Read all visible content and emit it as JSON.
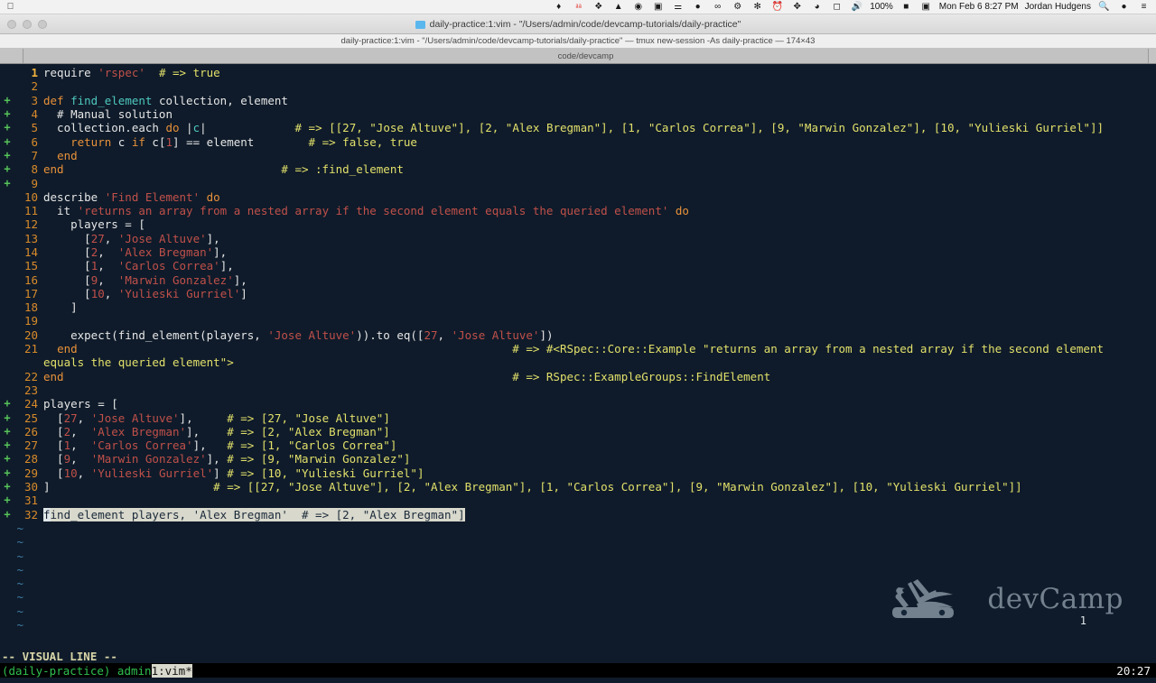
{
  "menubar": {
    "left_icons": [
      "apple-icon"
    ],
    "status_icons": [
      "pin-icon",
      "1password-icon",
      "dropbox-icon",
      "droplet-icon",
      "globe-icon",
      "camera-icon",
      "antenna-icon",
      "evernote-icon",
      "infinity-icon",
      "robot-icon",
      "bug-icon",
      "clock-icon",
      "bluetooth-icon",
      "wifi-icon",
      "airplay-icon",
      "volume-icon"
    ],
    "battery_text": "100%",
    "battery_icon": "battery-icon",
    "screen_icon": "display-icon",
    "datetime": "Mon Feb 6  8:27 PM",
    "user": "Jordan Hudgens",
    "search_icon": "search-icon",
    "siri_icon": "siri-icon",
    "notification_icon": "notification-center-icon"
  },
  "window": {
    "title": "daily-practice:1:vim - \"/Users/admin/code/devcamp-tutorials/daily-practice\"",
    "folder_icon": "folder-icon",
    "subtitle": "daily-practice:1:vim - \"/Users/admin/code/devcamp-tutorials/daily-practice\"  — tmux new-session -As daily-practice — 174×43",
    "tab_label": "code/devcamp"
  },
  "editor": {
    "lines": [
      {
        "sign": "",
        "num": "1",
        "cur": true,
        "segs": [
          {
            "t": "require ",
            "c": "c-plain"
          },
          {
            "t": "'rspec'",
            "c": "c-str"
          },
          {
            "t": "  ",
            "c": "c-plain"
          },
          {
            "t": "# => true",
            "c": "c-cmt"
          }
        ]
      },
      {
        "sign": "",
        "num": "2",
        "segs": []
      },
      {
        "sign": "+",
        "num": "3",
        "segs": [
          {
            "t": "def ",
            "c": "c-kw"
          },
          {
            "t": "find_element",
            "c": "c-func"
          },
          {
            "t": " collection, element",
            "c": "c-plain"
          }
        ]
      },
      {
        "sign": "+",
        "num": "4",
        "segs": [
          {
            "t": "  # Manual solution",
            "c": "c-plain"
          }
        ]
      },
      {
        "sign": "+",
        "num": "5",
        "segs": [
          {
            "t": "  collection.each ",
            "c": "c-plain"
          },
          {
            "t": "do",
            "c": "c-kw"
          },
          {
            "t": " |",
            "c": "c-plain"
          },
          {
            "t": "c",
            "c": "c-func"
          },
          {
            "t": "|",
            "c": "c-plain"
          },
          {
            "t": "             ",
            "c": "c-plain"
          },
          {
            "t": "# => [[27, \"Jose Altuve\"], [2, \"Alex Bregman\"], [1, \"Carlos Correa\"], [9, \"Marwin Gonzalez\"], [10, \"Yulieski Gurriel\"]]",
            "c": "c-cmt"
          }
        ]
      },
      {
        "sign": "+",
        "num": "6",
        "segs": [
          {
            "t": "    ",
            "c": "c-plain"
          },
          {
            "t": "return",
            "c": "c-kw"
          },
          {
            "t": " c ",
            "c": "c-plain"
          },
          {
            "t": "if",
            "c": "c-kw"
          },
          {
            "t": " c[",
            "c": "c-plain"
          },
          {
            "t": "1",
            "c": "c-num"
          },
          {
            "t": "] == element",
            "c": "c-plain"
          },
          {
            "t": "        ",
            "c": "c-plain"
          },
          {
            "t": "# => false, true",
            "c": "c-cmt"
          }
        ]
      },
      {
        "sign": "+",
        "num": "7",
        "segs": [
          {
            "t": "  ",
            "c": "c-plain"
          },
          {
            "t": "end",
            "c": "c-kw"
          }
        ]
      },
      {
        "sign": "+",
        "num": "8",
        "segs": [
          {
            "t": "end",
            "c": "c-kw"
          },
          {
            "t": "                                ",
            "c": "c-plain"
          },
          {
            "t": "# => :find_element",
            "c": "c-cmt"
          }
        ]
      },
      {
        "sign": "+",
        "num": "9",
        "segs": []
      },
      {
        "sign": "",
        "num": "10",
        "segs": [
          {
            "t": "describe ",
            "c": "c-plain"
          },
          {
            "t": "'Find Element'",
            "c": "c-str"
          },
          {
            "t": " ",
            "c": "c-plain"
          },
          {
            "t": "do",
            "c": "c-kw"
          }
        ]
      },
      {
        "sign": "",
        "num": "11",
        "segs": [
          {
            "t": "  it ",
            "c": "c-plain"
          },
          {
            "t": "'returns an array from a nested array if the second element equals the queried element'",
            "c": "c-str"
          },
          {
            "t": " ",
            "c": "c-plain"
          },
          {
            "t": "do",
            "c": "c-kw"
          }
        ]
      },
      {
        "sign": "",
        "num": "12",
        "segs": [
          {
            "t": "    players = [",
            "c": "c-plain"
          }
        ]
      },
      {
        "sign": "",
        "num": "13",
        "segs": [
          {
            "t": "      [",
            "c": "c-plain"
          },
          {
            "t": "27",
            "c": "c-num"
          },
          {
            "t": ", ",
            "c": "c-plain"
          },
          {
            "t": "'Jose Altuve'",
            "c": "c-str"
          },
          {
            "t": "],",
            "c": "c-plain"
          }
        ]
      },
      {
        "sign": "",
        "num": "14",
        "segs": [
          {
            "t": "      [",
            "c": "c-plain"
          },
          {
            "t": "2",
            "c": "c-num"
          },
          {
            "t": ",  ",
            "c": "c-plain"
          },
          {
            "t": "'Alex Bregman'",
            "c": "c-str"
          },
          {
            "t": "],",
            "c": "c-plain"
          }
        ]
      },
      {
        "sign": "",
        "num": "15",
        "segs": [
          {
            "t": "      [",
            "c": "c-plain"
          },
          {
            "t": "1",
            "c": "c-num"
          },
          {
            "t": ",  ",
            "c": "c-plain"
          },
          {
            "t": "'Carlos Correa'",
            "c": "c-str"
          },
          {
            "t": "],",
            "c": "c-plain"
          }
        ]
      },
      {
        "sign": "",
        "num": "16",
        "segs": [
          {
            "t": "      [",
            "c": "c-plain"
          },
          {
            "t": "9",
            "c": "c-num"
          },
          {
            "t": ",  ",
            "c": "c-plain"
          },
          {
            "t": "'Marwin Gonzalez'",
            "c": "c-str"
          },
          {
            "t": "],",
            "c": "c-plain"
          }
        ]
      },
      {
        "sign": "",
        "num": "17",
        "segs": [
          {
            "t": "      [",
            "c": "c-plain"
          },
          {
            "t": "10",
            "c": "c-num"
          },
          {
            "t": ", ",
            "c": "c-plain"
          },
          {
            "t": "'Yulieski Gurriel'",
            "c": "c-str"
          },
          {
            "t": "]",
            "c": "c-plain"
          }
        ]
      },
      {
        "sign": "",
        "num": "18",
        "segs": [
          {
            "t": "    ]",
            "c": "c-plain"
          }
        ]
      },
      {
        "sign": "",
        "num": "19",
        "segs": []
      },
      {
        "sign": "",
        "num": "20",
        "segs": [
          {
            "t": "    expect(find_element(players, ",
            "c": "c-plain"
          },
          {
            "t": "'Jose Altuve'",
            "c": "c-str"
          },
          {
            "t": ")).to eq([",
            "c": "c-plain"
          },
          {
            "t": "27",
            "c": "c-num"
          },
          {
            "t": ", ",
            "c": "c-plain"
          },
          {
            "t": "'Jose Altuve'",
            "c": "c-str"
          },
          {
            "t": "])",
            "c": "c-plain"
          }
        ]
      },
      {
        "sign": "",
        "num": "21",
        "segs": [
          {
            "t": "  ",
            "c": "c-plain"
          },
          {
            "t": "end",
            "c": "c-kw"
          },
          {
            "t": "                                                                ",
            "c": "c-plain"
          },
          {
            "t": "# => #<RSpec::Core::Example \"returns an array from a nested array if the second element",
            "c": "c-cmt"
          }
        ]
      },
      {
        "sign": "",
        "num": "",
        "wrap": true,
        "segs": [
          {
            "t": "equals the queried element\">",
            "c": "c-cmt"
          }
        ]
      },
      {
        "sign": "",
        "num": "22",
        "segs": [
          {
            "t": "end",
            "c": "c-kw"
          },
          {
            "t": "                                                                  ",
            "c": "c-plain"
          },
          {
            "t": "# => RSpec::ExampleGroups::FindElement",
            "c": "c-cmt"
          }
        ]
      },
      {
        "sign": "",
        "num": "23",
        "segs": []
      },
      {
        "sign": "+",
        "num": "24",
        "segs": [
          {
            "t": "players = [",
            "c": "c-plain"
          }
        ]
      },
      {
        "sign": "+",
        "num": "25",
        "segs": [
          {
            "t": "  [",
            "c": "c-plain"
          },
          {
            "t": "27",
            "c": "c-num"
          },
          {
            "t": ", ",
            "c": "c-plain"
          },
          {
            "t": "'Jose Altuve'",
            "c": "c-str"
          },
          {
            "t": "],     ",
            "c": "c-plain"
          },
          {
            "t": "# => [27, \"Jose Altuve\"]",
            "c": "c-cmt"
          }
        ]
      },
      {
        "sign": "+",
        "num": "26",
        "segs": [
          {
            "t": "  [",
            "c": "c-plain"
          },
          {
            "t": "2",
            "c": "c-num"
          },
          {
            "t": ",  ",
            "c": "c-plain"
          },
          {
            "t": "'Alex Bregman'",
            "c": "c-str"
          },
          {
            "t": "],    ",
            "c": "c-plain"
          },
          {
            "t": "# => [2, \"Alex Bregman\"]",
            "c": "c-cmt"
          }
        ]
      },
      {
        "sign": "+",
        "num": "27",
        "segs": [
          {
            "t": "  [",
            "c": "c-plain"
          },
          {
            "t": "1",
            "c": "c-num"
          },
          {
            "t": ",  ",
            "c": "c-plain"
          },
          {
            "t": "'Carlos Correa'",
            "c": "c-str"
          },
          {
            "t": "],   ",
            "c": "c-plain"
          },
          {
            "t": "# => [1, \"Carlos Correa\"]",
            "c": "c-cmt"
          }
        ]
      },
      {
        "sign": "+",
        "num": "28",
        "segs": [
          {
            "t": "  [",
            "c": "c-plain"
          },
          {
            "t": "9",
            "c": "c-num"
          },
          {
            "t": ",  ",
            "c": "c-plain"
          },
          {
            "t": "'Marwin Gonzalez'",
            "c": "c-str"
          },
          {
            "t": "], ",
            "c": "c-plain"
          },
          {
            "t": "# => [9, \"Marwin Gonzalez\"]",
            "c": "c-cmt"
          }
        ]
      },
      {
        "sign": "+",
        "num": "29",
        "segs": [
          {
            "t": "  [",
            "c": "c-plain"
          },
          {
            "t": "10",
            "c": "c-num"
          },
          {
            "t": ", ",
            "c": "c-plain"
          },
          {
            "t": "'Yulieski Gurriel'",
            "c": "c-str"
          },
          {
            "t": "] ",
            "c": "c-plain"
          },
          {
            "t": "# => [10, \"Yulieski Gurriel\"]",
            "c": "c-cmt"
          }
        ]
      },
      {
        "sign": "+",
        "num": "30",
        "segs": [
          {
            "t": "]",
            "c": "c-plain"
          },
          {
            "t": "                        ",
            "c": "c-plain"
          },
          {
            "t": "# => [[27, \"Jose Altuve\"], [2, \"Alex Bregman\"], [1, \"Carlos Correa\"], [9, \"Marwin Gonzalez\"], [10, \"Yulieski Gurriel\"]]",
            "c": "c-cmt"
          }
        ]
      },
      {
        "sign": "+",
        "num": "31",
        "segs": []
      },
      {
        "sign": "+",
        "num": "32",
        "selected": true,
        "segs": [
          {
            "t": "f",
            "c": "cursor"
          },
          {
            "t": "ind_element players, ",
            "c": "sel"
          },
          {
            "t": "'Alex Bregman'",
            "c": "sel"
          },
          {
            "t": "  ",
            "c": "sel"
          },
          {
            "t": "# => [2, \"Alex Bregman\"]",
            "c": "sel"
          }
        ]
      }
    ],
    "tilde_count": 8,
    "tilde_char": "~",
    "logo_text": "devCamp",
    "logo_icon": "swiss-army-knife-icon",
    "right_count": "1"
  },
  "statusline": {
    "mode": "-- VISUAL LINE --"
  },
  "tmux": {
    "left": "(daily-practice) admin",
    "window": "1:vim*",
    "right": "20:27"
  },
  "colors": {
    "bg": "#0f1b2a",
    "comment": "#e2e06a",
    "string": "#c0504a",
    "keyword": "#e8913a",
    "function": "#4ec9c0",
    "linenum": "#d88a2b",
    "sign_add": "#57c45a",
    "selection": "#d8d8cc",
    "tmux_green": "#2fbf4f"
  }
}
